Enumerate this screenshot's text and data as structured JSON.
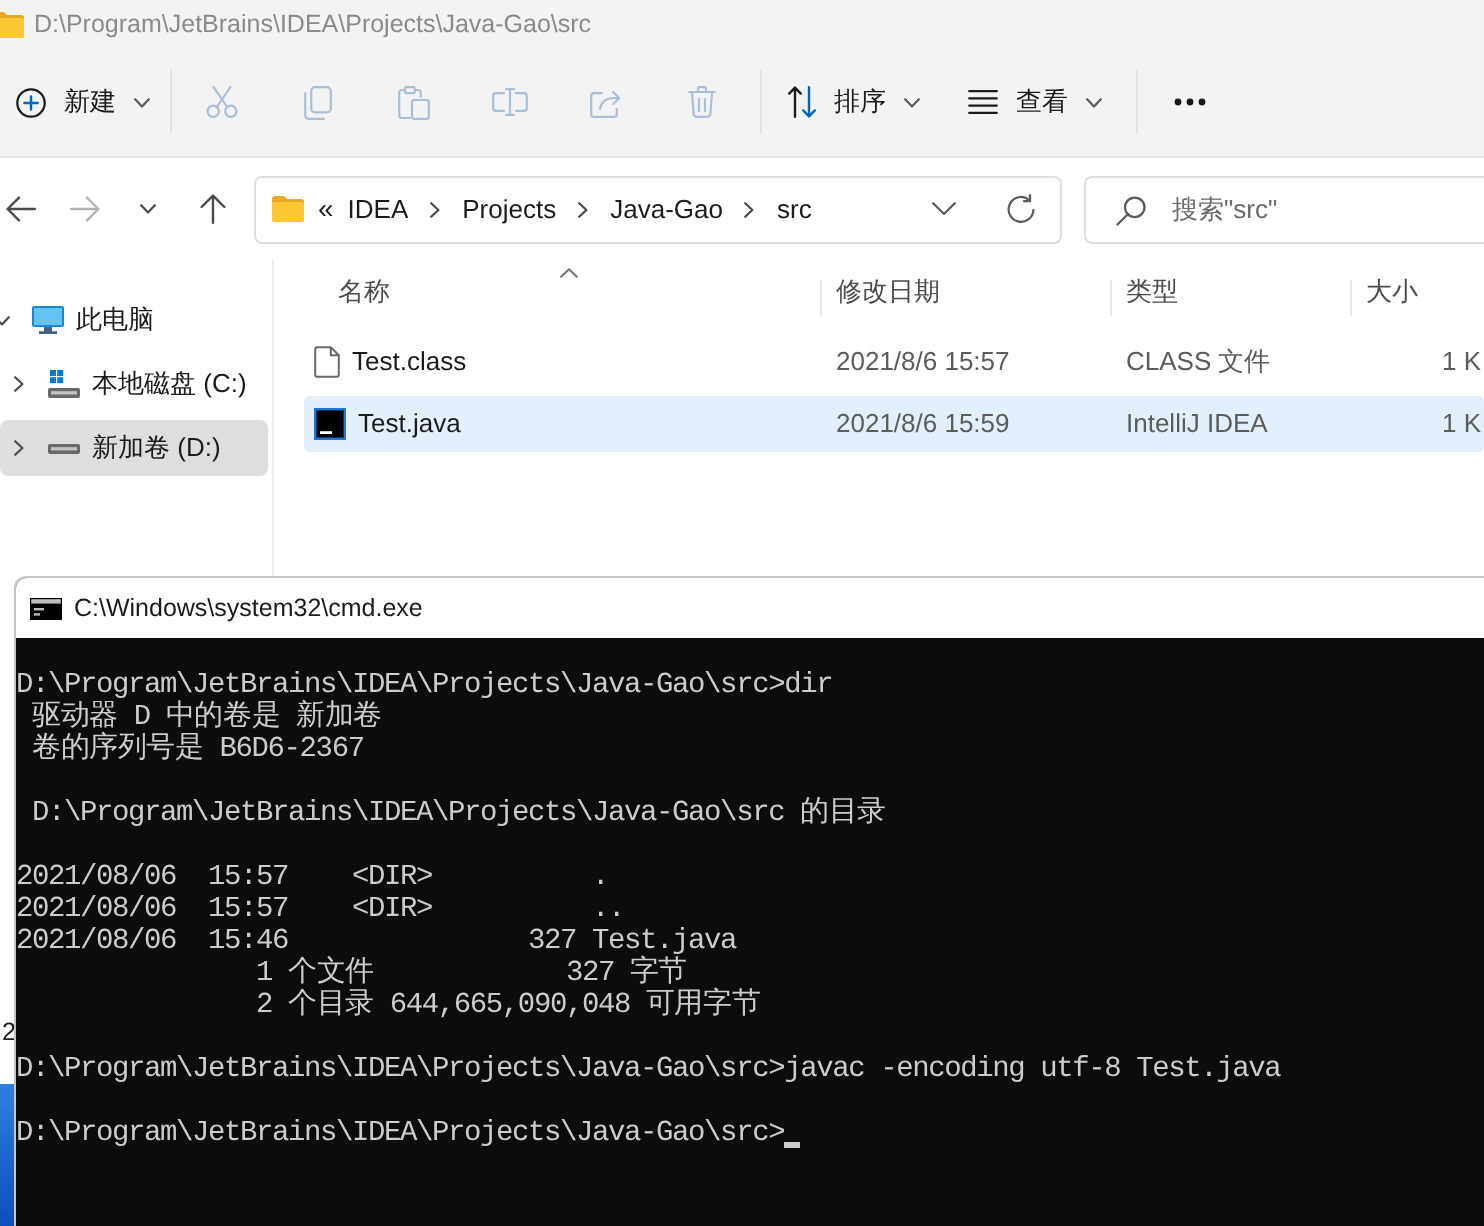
{
  "explorer": {
    "title": "D:\\Program\\JetBrains\\IDEA\\Projects\\Java-Gao\\src",
    "toolbar": {
      "new_button": {
        "label": "新建",
        "disabled": false
      },
      "cut_button": {
        "disabled": true
      },
      "copy_button": {
        "disabled": true
      },
      "paste_button": {
        "disabled": true
      },
      "rename_button": {
        "disabled": true
      },
      "share_button": {
        "disabled": true
      },
      "delete_button": {
        "disabled": true
      },
      "sort_button": {
        "label": "排序",
        "disabled": false
      },
      "view_button": {
        "label": "查看",
        "disabled": false
      },
      "more_button": {
        "disabled": false
      }
    },
    "navigation": {
      "back_button": {
        "disabled": false
      },
      "forward_button": {
        "disabled": true
      },
      "recent_button": {
        "disabled": false
      },
      "up_button": {
        "disabled": false
      }
    },
    "address_bar": {
      "overflow": "«",
      "crumbs": [
        "IDEA",
        "Projects",
        "Java-Gao",
        "src"
      ]
    },
    "search": {
      "placeholder": "搜索\"src\""
    },
    "sidebar": {
      "items": [
        {
          "kind": "computer",
          "label": "此电脑",
          "expanded": true,
          "selected": false,
          "children": [
            {
              "kind": "system_drive",
              "label": "本地磁盘 (C:)",
              "expanded": false,
              "selected": false
            },
            {
              "kind": "drive",
              "label": "新加卷 (D:)",
              "expanded": false,
              "selected": true
            }
          ]
        }
      ]
    },
    "files": {
      "columns": [
        {
          "label": "名称",
          "sorted": true
        },
        {
          "label": "修改日期",
          "sorted": false
        },
        {
          "label": "类型",
          "sorted": false
        },
        {
          "label": "大小",
          "sorted": false
        }
      ],
      "rows": [
        {
          "kind": "blank",
          "name": "Test.class",
          "modified": "2021/8/6 15:57",
          "type": "CLASS 文件",
          "size": "1 K",
          "selected": false
        },
        {
          "kind": "intellij",
          "name": "Test.java",
          "modified": "2021/8/6 15:59",
          "type": "IntelliJ IDEA",
          "size": "1 K",
          "selected": true
        }
      ]
    },
    "status_bar": {
      "item_count": "2"
    }
  },
  "console": {
    "title": "C:\\Windows\\system32\\cmd.exe",
    "blocks": [
      [
        "D:\\Program\\JetBrains\\IDEA\\Projects\\Java-Gao\\src>dir",
        " 驱动器 D 中的卷是 新加卷",
        " 卷的序列号是 B6D6-2367"
      ],
      [
        " D:\\Program\\JetBrains\\IDEA\\Projects\\Java-Gao\\src 的目录"
      ],
      [
        "2021/08/06  15:57    <DIR>          .",
        "2021/08/06  15:57    <DIR>          ..",
        "2021/08/06  15:46               327 Test.java",
        "               1 个文件            327 字节",
        "               2 个目录 644,665,090,048 可用字节"
      ],
      [
        "D:\\Program\\JetBrains\\IDEA\\Projects\\Java-Gao\\src>javac -encoding utf-8 Test.java"
      ],
      [
        "D:\\Program\\JetBrains\\IDEA\\Projects\\Java-Gao\\src>"
      ]
    ],
    "cursor": true
  }
}
